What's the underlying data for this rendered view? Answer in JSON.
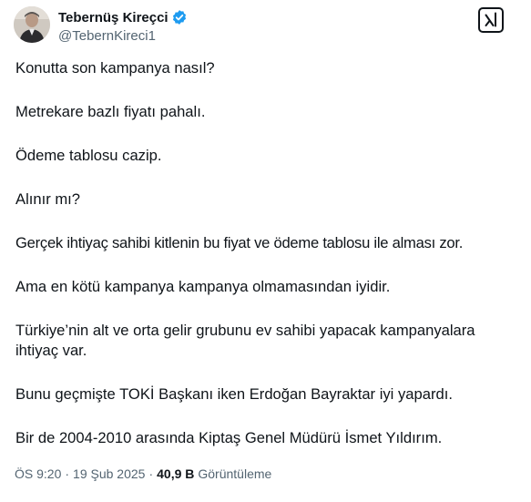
{
  "author": {
    "display_name": "Tebernüş Kireçci",
    "handle": "@TebernKireci1",
    "verified": true
  },
  "actions": {
    "grok_icon": "grok-icon"
  },
  "tweet": {
    "paragraphs": [
      "Konutta son kampanya nasıl?",
      "Metrekare bazlı fiyatı pahalı.",
      "Ödeme tablosu cazip.",
      "Alınır mı?",
      "Gerçek ihtiyaç sahibi kitlenin bu fiyat ve ödeme tablosu ile alması zor.",
      "Ama en kötü kampanya kampanya olmamasından iyidir.",
      "Türkiye’nin alt ve orta gelir grubunu ev sahibi yapacak kampanyalara ihtiyaç var.",
      "Bunu geçmişte TOKİ Başkanı iken Erdoğan Bayraktar iyi yapardı.",
      "Bir de 2004-2010 arasında Kiptaş Genel Müdürü İsmet Yıldırım."
    ]
  },
  "meta": {
    "time": "ÖS 9:20",
    "separator": "·",
    "date": "19 Şub 2025",
    "views_count": "40,9 B",
    "views_label": "Görüntüleme"
  },
  "colors": {
    "text": "#0f1419",
    "secondary": "#536471",
    "verified": "#1d9bf0"
  }
}
